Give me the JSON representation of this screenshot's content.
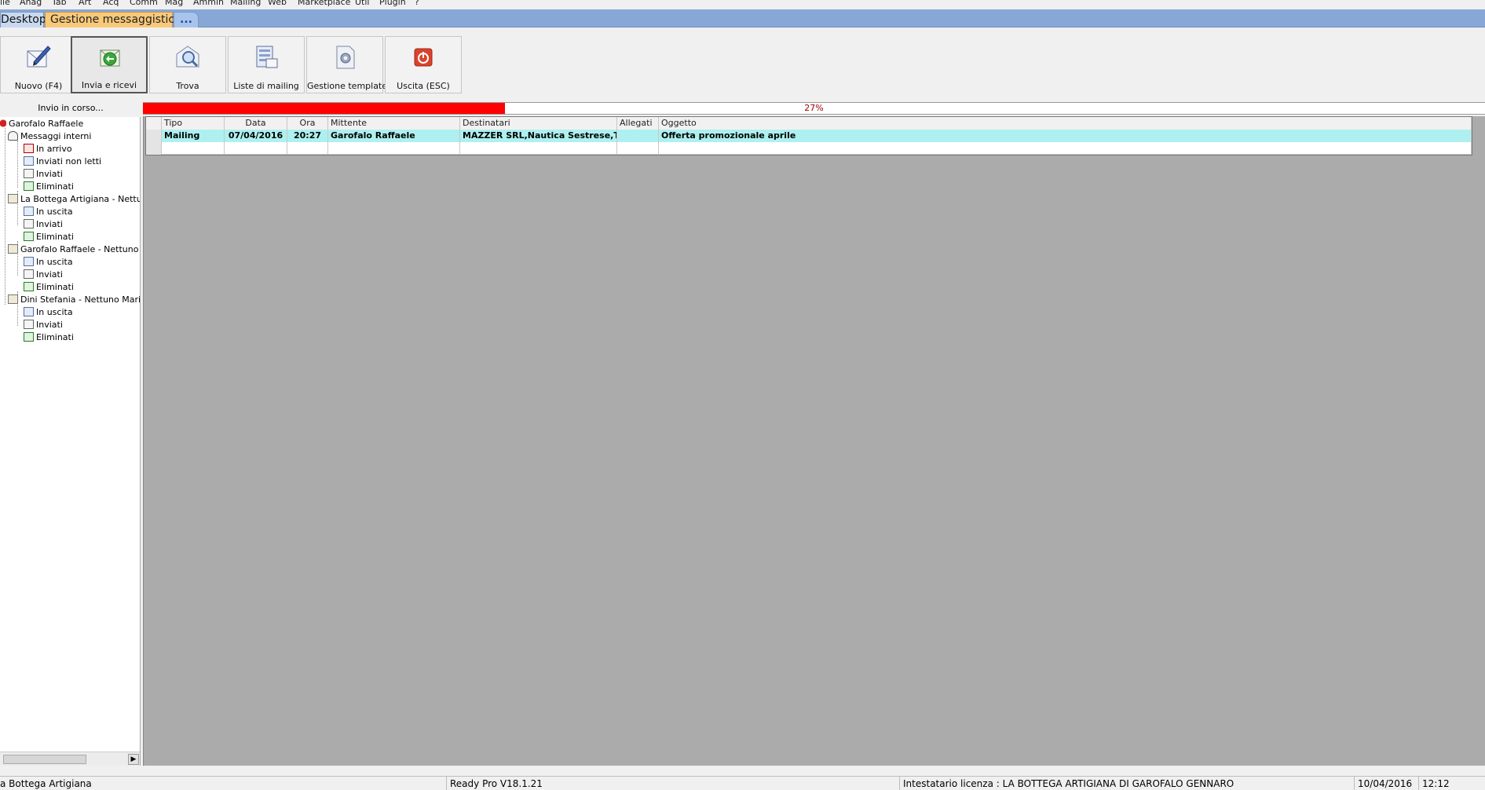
{
  "menu": [
    "ile",
    "Anag",
    "Tab",
    "Art",
    "Acq",
    "Comm",
    "Mag",
    "Ammin",
    "Mailing",
    "Web",
    "Marketplace",
    "Util",
    "Plugin",
    "?"
  ],
  "tabs": {
    "desktop": "Desktop",
    "messaggistica": "Gestione messaggistica",
    "more": "..."
  },
  "toolbar": {
    "nuovo": "Nuovo (F4)",
    "invia": "Invia e ricevi",
    "trova": "Trova",
    "liste": "Liste di mailing",
    "template": "Gestione template",
    "uscita": "Uscita (ESC)"
  },
  "progress": {
    "status": "Invio in corso...",
    "percent_text": "27%",
    "fraction": 0.27,
    "fill_color": "#ff0000"
  },
  "tree": {
    "root": "Garofalo Raffaele",
    "interni": "Messaggi interni",
    "interni_items": [
      "In arrivo",
      "Inviati non letti",
      "Inviati",
      "Eliminati"
    ],
    "account1": "La Bottega Artigiana - Nettuno",
    "account2": "Garofalo Raffaele - Nettuno Ma",
    "account3": "Dini Stefania - Nettuno Marine",
    "account_items": [
      "In uscita",
      "Inviati",
      "Eliminati"
    ]
  },
  "grid": {
    "headers": [
      "Tipo",
      "Data",
      "Ora",
      "Mittente",
      "Destinatari",
      "Allegati",
      "Oggetto"
    ],
    "row": {
      "tipo": "Mailing",
      "data": "07/04/2016",
      "ora": "20:27",
      "mittente": "Garofalo Raffaele",
      "destinatari": "MAZZER SRL,Nautica Sestrese,T...",
      "allegati": "",
      "oggetto": "Offerta promozionale aprile"
    },
    "selected_color": "#aef0f0"
  },
  "statusbar": {
    "company": "a Bottega Artigiana",
    "version": "Ready Pro V18.1.21",
    "license": "Intestatario licenza : LA BOTTEGA ARTIGIANA DI GAROFALO GENNARO",
    "date": "10/04/2016",
    "time": "12:12"
  }
}
